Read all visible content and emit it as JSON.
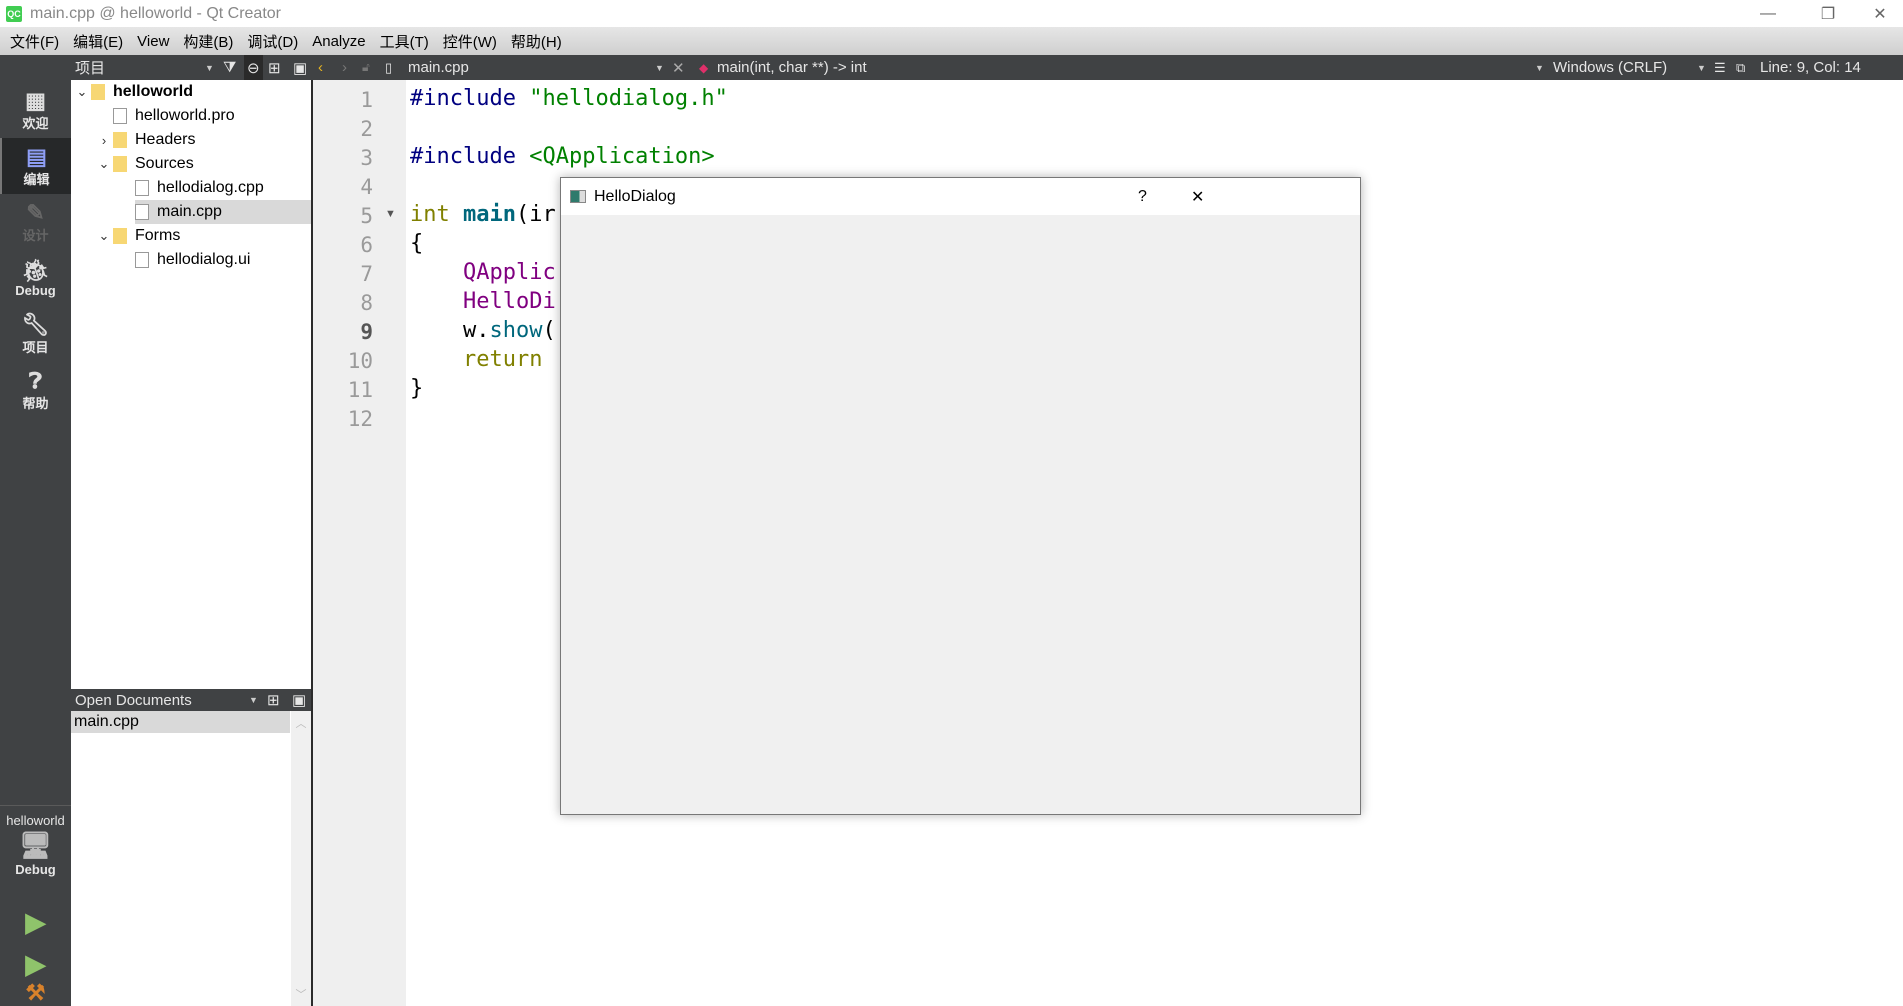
{
  "window": {
    "title": "main.cpp @ helloworld - Qt Creator",
    "logo": "QC",
    "controls": [
      "minimize",
      "restore",
      "close"
    ]
  },
  "menu": [
    "文件(F)",
    "编辑(E)",
    "View",
    "构建(B)",
    "调试(D)",
    "Analyze",
    "工具(T)",
    "控件(W)",
    "帮助(H)"
  ],
  "toolbar": {
    "panel_title": "项目",
    "file": "main.cpp",
    "symbol": "main(int, char **) -> int",
    "line_ending": "Windows (CRLF)",
    "position": "Line: 9, Col: 14"
  },
  "modes": [
    {
      "label": "欢迎",
      "icon": "grid-icon"
    },
    {
      "label": "编辑",
      "icon": "edit-icon",
      "active": true
    },
    {
      "label": "设计",
      "icon": "pencil-icon",
      "disabled": true
    },
    {
      "label": "Debug",
      "icon": "bug-icon"
    },
    {
      "label": "项目",
      "icon": "wrench-icon"
    },
    {
      "label": "帮助",
      "icon": "help-icon"
    }
  ],
  "target": {
    "project": "helloworld",
    "config": "Debug"
  },
  "tree": [
    {
      "label": "helloworld",
      "level": 0,
      "expanded": true,
      "bold": true
    },
    {
      "label": "helloworld.pro",
      "level": 1
    },
    {
      "label": "Headers",
      "level": 1,
      "expanded": false
    },
    {
      "label": "Sources",
      "level": 1,
      "expanded": true
    },
    {
      "label": "hellodialog.cpp",
      "level": 2
    },
    {
      "label": "main.cpp",
      "level": 2,
      "selected": true
    },
    {
      "label": "Forms",
      "level": 1,
      "expanded": true
    },
    {
      "label": "hellodialog.ui",
      "level": 2
    }
  ],
  "open_documents": {
    "title": "Open Documents",
    "items": [
      "main.cpp"
    ]
  },
  "editor": {
    "current_line": 9,
    "lines": [
      [
        {
          "t": "#include ",
          "c": "#000080"
        },
        {
          "t": "\"hellodialog.h\"",
          "c": "#008000"
        }
      ],
      [],
      [
        {
          "t": "#include ",
          "c": "#000080"
        },
        {
          "t": "<QApplication>",
          "c": "#008000"
        }
      ],
      [],
      [
        {
          "t": "int ",
          "c": "#808000"
        },
        {
          "t": "main",
          "c": "#00677c",
          "b": true
        },
        {
          "t": "(ir",
          "c": "#000"
        }
      ],
      [
        {
          "t": "{",
          "c": "#000"
        }
      ],
      [
        {
          "t": "    QApplic",
          "c": "#800080"
        }
      ],
      [
        {
          "t": "    HelloDi",
          "c": "#800080"
        }
      ],
      [
        {
          "t": "    w.",
          "c": "#000"
        },
        {
          "t": "show",
          "c": "#00677c"
        },
        {
          "t": "(",
          "c": "#000"
        }
      ],
      [
        {
          "t": "    return ",
          "c": "#808000"
        }
      ],
      [
        {
          "t": "}",
          "c": "#000"
        }
      ],
      []
    ]
  },
  "dialog": {
    "title": "HelloDialog",
    "help": "?",
    "close": "✕"
  },
  "colors": {
    "dark": "#404244",
    "accent": "#41cd52"
  }
}
